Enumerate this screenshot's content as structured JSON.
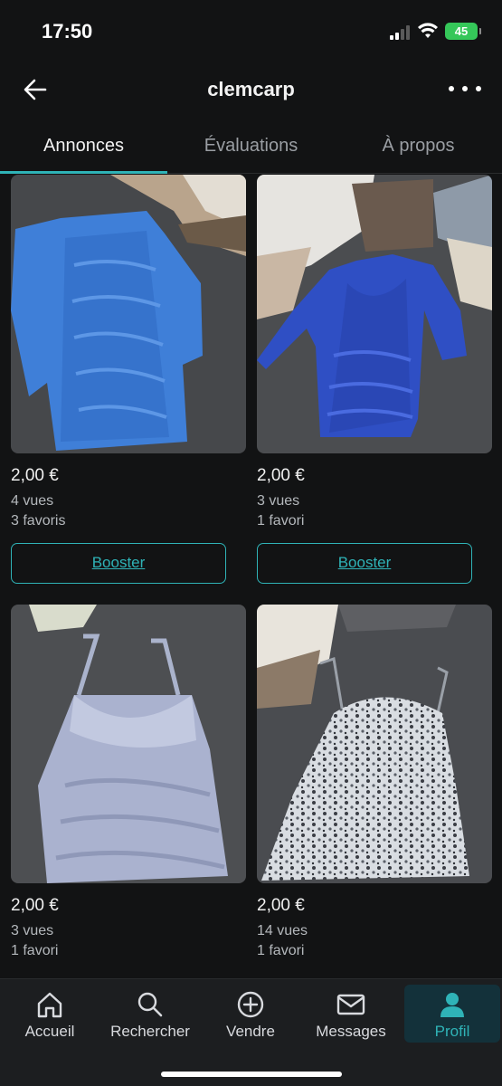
{
  "status_bar": {
    "time": "17:50",
    "battery": "45"
  },
  "header": {
    "title": "clemcarp"
  },
  "tabs": [
    {
      "label": "Annonces",
      "active": true
    },
    {
      "label": "Évaluations",
      "active": false
    },
    {
      "label": "À propos",
      "active": false
    }
  ],
  "listings": [
    {
      "price": "2,00 €",
      "views": "4 vues",
      "favorites": "3 favoris",
      "action": "Booster"
    },
    {
      "price": "2,00 €",
      "views": "3 vues",
      "favorites": "1 favori",
      "action": "Booster"
    },
    {
      "price": "2,00 €",
      "views": "3 vues",
      "favorites": "1 favori"
    },
    {
      "price": "2,00 €",
      "views": "14 vues",
      "favorites": "1 favori"
    }
  ],
  "nav": [
    {
      "label": "Accueil",
      "icon": "home-icon"
    },
    {
      "label": "Rechercher",
      "icon": "search-icon"
    },
    {
      "label": "Vendre",
      "icon": "plus-circle-icon"
    },
    {
      "label": "Messages",
      "icon": "mail-icon"
    },
    {
      "label": "Profil",
      "icon": "profile-icon",
      "active": true
    }
  ],
  "colors": {
    "accent": "#2fb3b7",
    "background": "#121314",
    "nav_background": "#1c1e20"
  }
}
